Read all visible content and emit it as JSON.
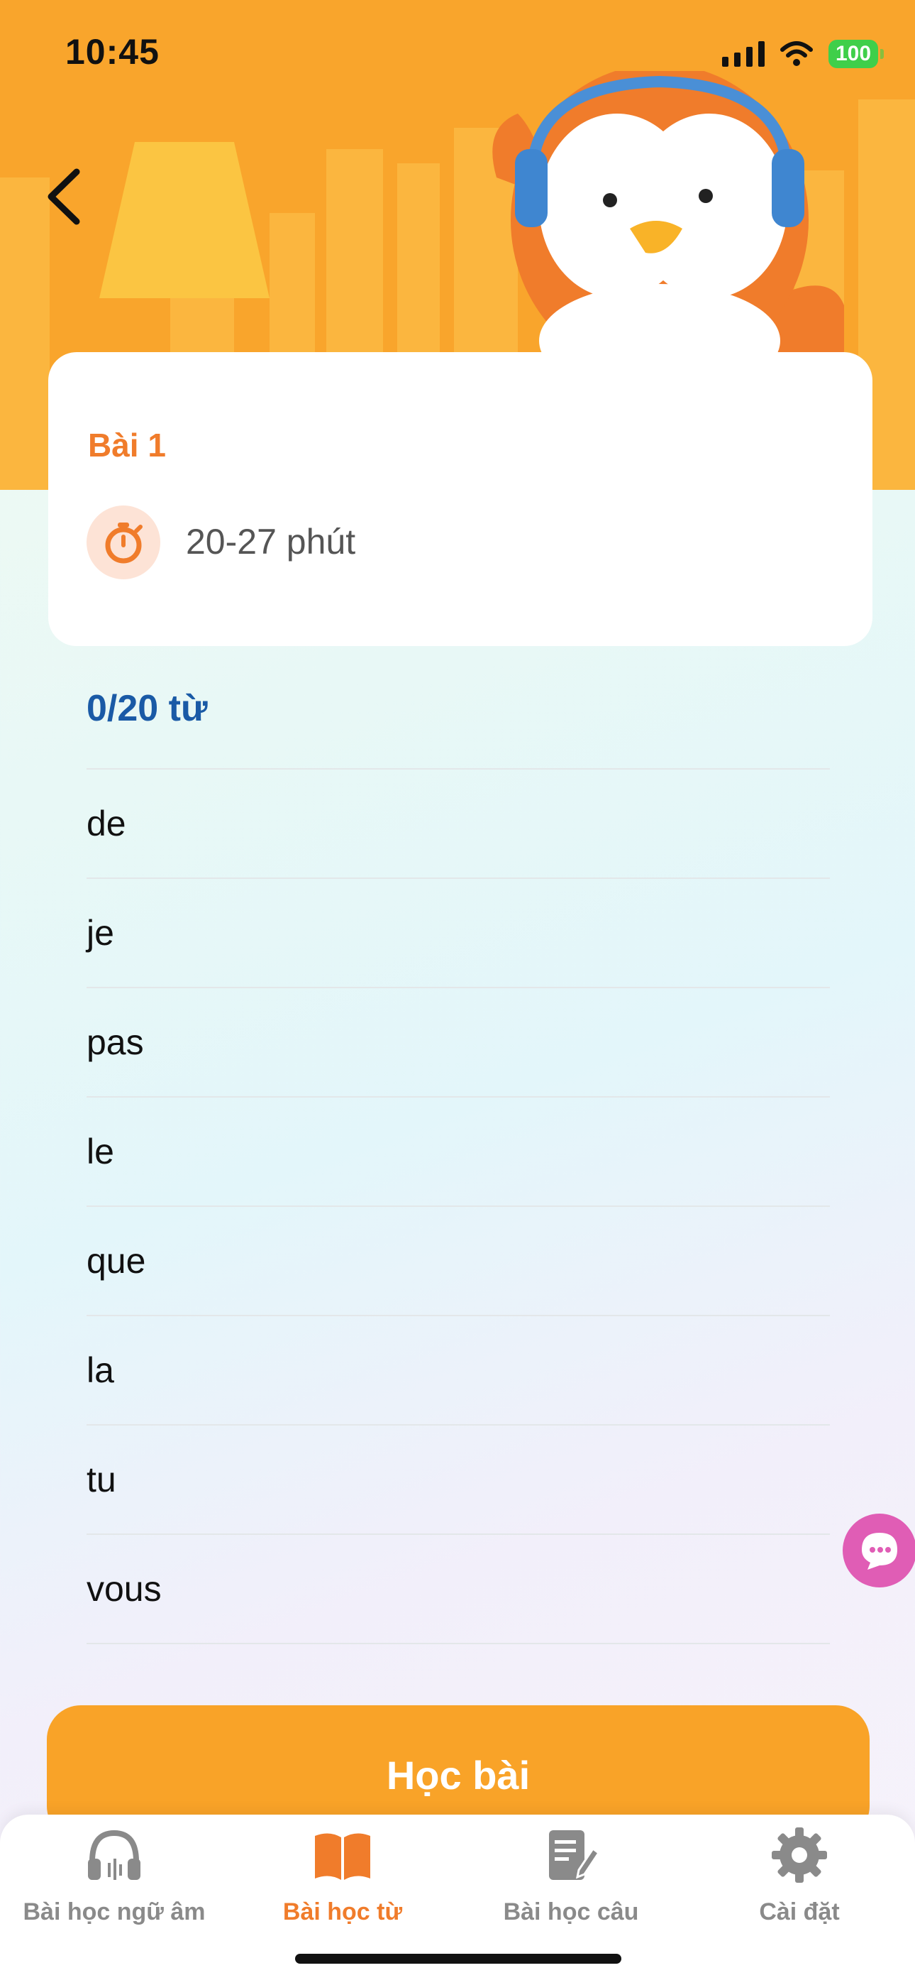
{
  "status_bar": {
    "time": "10:45",
    "battery": "100"
  },
  "lesson": {
    "title": "Bài 1",
    "duration": "20-27 phút"
  },
  "progress": "0/20 từ",
  "words": [
    "de",
    "je",
    "pas",
    "le",
    "que",
    "la",
    "tu",
    "vous"
  ],
  "primary_button": "Học bài",
  "tabs": [
    {
      "label": "Bài học ngữ âm",
      "icon": "headphones-icon",
      "active": false
    },
    {
      "label": "Bài học từ",
      "icon": "book-icon",
      "active": true
    },
    {
      "label": "Bài học câu",
      "icon": "edit-document-icon",
      "active": false
    },
    {
      "label": "Cài đặt",
      "icon": "gear-icon",
      "active": false
    }
  ],
  "colors": {
    "header": "#f9a52c",
    "accent": "#f07c2b",
    "progress": "#1a5aa6",
    "button": "#f9a328",
    "chat_fab": "#e05db5"
  }
}
